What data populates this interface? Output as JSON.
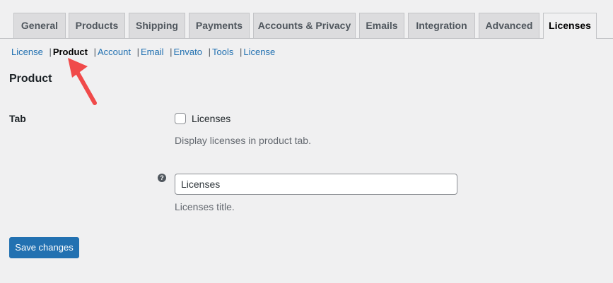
{
  "tabs": [
    {
      "label": "General"
    },
    {
      "label": "Products"
    },
    {
      "label": "Shipping"
    },
    {
      "label": "Payments"
    },
    {
      "label": "Accounts & Privacy"
    },
    {
      "label": "Emails"
    },
    {
      "label": "Integration"
    },
    {
      "label": "Advanced"
    },
    {
      "label": "Licenses",
      "active": true
    }
  ],
  "subnav": [
    {
      "label": "License"
    },
    {
      "label": "Product",
      "current": true
    },
    {
      "label": "Account"
    },
    {
      "label": "Email"
    },
    {
      "label": "Envato"
    },
    {
      "label": "Tools"
    },
    {
      "label": "License"
    }
  ],
  "subnav_separator": "|",
  "section": {
    "title": "Product"
  },
  "tab_setting": {
    "label": "Tab",
    "checkbox_label": "Licenses",
    "checked": false,
    "description": "Display licenses in product tab."
  },
  "title_setting": {
    "help_icon": "?",
    "value": "Licenses",
    "description": "Licenses title."
  },
  "save_button": {
    "label": "Save changes"
  },
  "colors": {
    "accent": "#2271b1",
    "annotation_arrow": "#f04a4a"
  },
  "icons": {
    "help": "question-circle-icon",
    "annotation": "red-arrow-icon"
  }
}
